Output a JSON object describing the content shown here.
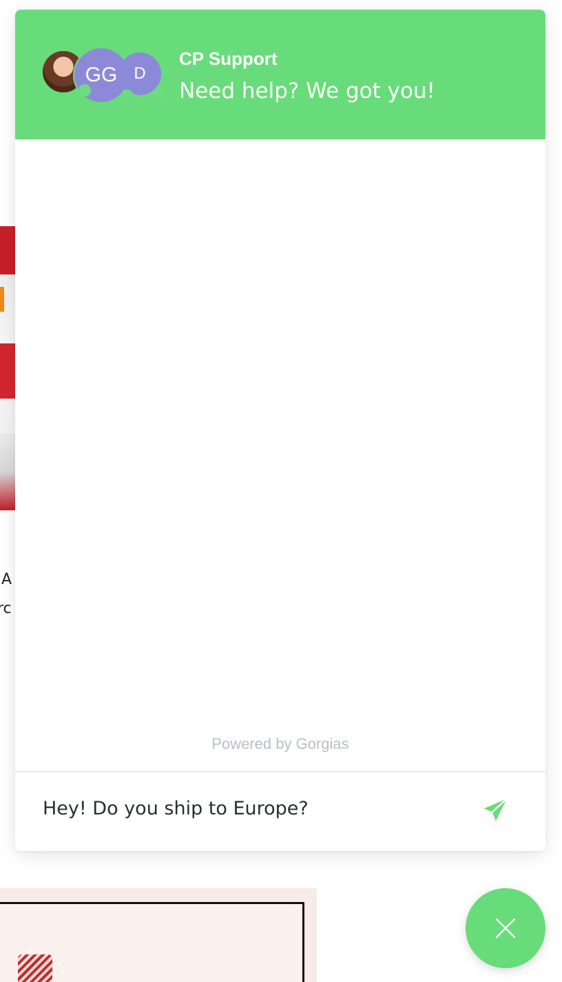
{
  "background_page": {
    "text_line_1": "A",
    "text_line_2": "rc"
  },
  "chat": {
    "header": {
      "title": "CP Support",
      "subtitle": "Need help? We got you!",
      "avatars": [
        {
          "type": "photo",
          "initials": ""
        },
        {
          "type": "initials",
          "initials": "GG"
        },
        {
          "type": "initials",
          "initials": "D"
        }
      ]
    },
    "powered_by": "Powered by Gorgias",
    "composer": {
      "value": "Hey! Do you ship to Europe?"
    },
    "icons": {
      "send": "send-icon",
      "close": "close-icon"
    },
    "colors": {
      "accent": "#68dc7a",
      "avatar": "#8c8ad8",
      "muted_text": "#b8c0c8"
    }
  }
}
